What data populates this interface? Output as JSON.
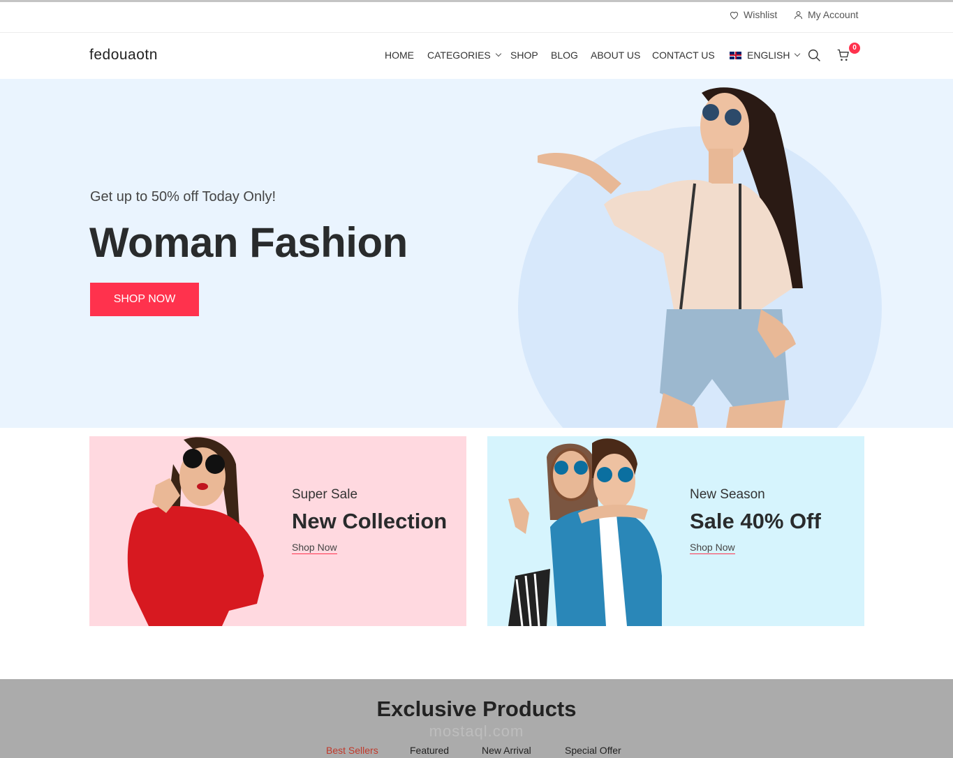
{
  "topbar": {
    "wishlist_label": "Wishlist",
    "account_label": "My Account"
  },
  "header": {
    "logo": "fedouaotn",
    "nav": {
      "home": "HOME",
      "categories": "CATEGORIES",
      "shop": "SHOP",
      "blog": "BLOG",
      "about": "ABOUT US",
      "contact": "CONTACT US",
      "language": "ENGLISH"
    },
    "cart_count": "0"
  },
  "hero": {
    "subtitle": "Get up to 50% off Today Only!",
    "title": "Woman Fashion",
    "button_label": "SHOP NOW"
  },
  "banners": [
    {
      "subtitle": "Super Sale",
      "title": "New Collection",
      "link": "Shop Now"
    },
    {
      "subtitle": "New Season",
      "title": "Sale 40% Off",
      "link": "Shop Now"
    }
  ],
  "exclusive": {
    "title": "Exclusive Products",
    "watermark": "mostaql.com",
    "tabs": [
      "Best Sellers",
      "Featured",
      "New Arrival",
      "Special Offer"
    ]
  },
  "colors": {
    "accent": "#ff324d",
    "hero_bg": "#eaf4fe",
    "banner_pink": "#ffd9e0",
    "banner_blue": "#d6f4fd"
  }
}
